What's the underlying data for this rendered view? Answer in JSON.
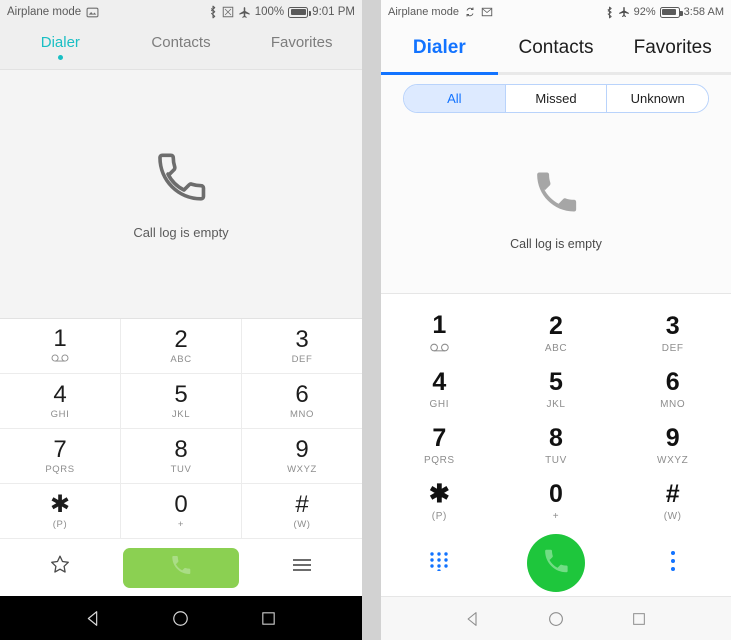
{
  "left_phone": {
    "status_bar": {
      "label": "Airplane mode",
      "icons_left": [
        "screenshot-icon"
      ],
      "icons_right": [
        "bluetooth-icon",
        "sim-icon",
        "airplane-icon"
      ],
      "battery_percent": "100%",
      "time": "9:01 PM"
    },
    "tabs": [
      {
        "label": "Dialer",
        "active": true
      },
      {
        "label": "Contacts",
        "active": false
      },
      {
        "label": "Favorites",
        "active": false
      }
    ],
    "empty_state": {
      "icon": "phone-outline-icon",
      "text": "Call log is empty"
    },
    "keypad": [
      {
        "digit": "1",
        "sub": "∞",
        "sub_is_voicemail": true
      },
      {
        "digit": "2",
        "sub": "ABC"
      },
      {
        "digit": "3",
        "sub": "DEF"
      },
      {
        "digit": "4",
        "sub": "GHI"
      },
      {
        "digit": "5",
        "sub": "JKL"
      },
      {
        "digit": "6",
        "sub": "MNO"
      },
      {
        "digit": "7",
        "sub": "PQRS"
      },
      {
        "digit": "8",
        "sub": "TUV"
      },
      {
        "digit": "9",
        "sub": "WXYZ"
      },
      {
        "digit": "✱",
        "sub": "(P)"
      },
      {
        "digit": "0",
        "sub": "+"
      },
      {
        "digit": "#",
        "sub": "(W)"
      }
    ],
    "action_row": {
      "left_icon": "star-outline-icon",
      "call_icon": "phone-call-icon",
      "right_icon": "hamburger-menu-icon"
    },
    "nav_bar": {
      "back": "back-triangle-icon",
      "home": "home-circle-icon",
      "recents": "recents-square-icon"
    },
    "accent_color": "#19bfc4",
    "call_button_color": "#8bd052"
  },
  "right_phone": {
    "status_bar": {
      "label": "Airplane mode",
      "icons_left": [
        "rotate-icon",
        "mail-icon"
      ],
      "icons_right": [
        "bluetooth-icon",
        "airplane-icon"
      ],
      "battery_percent": "92%",
      "time": "3:58 AM"
    },
    "tabs": [
      {
        "label": "Dialer",
        "active": true
      },
      {
        "label": "Contacts",
        "active": false
      },
      {
        "label": "Favorites",
        "active": false
      }
    ],
    "filters": [
      {
        "label": "All",
        "active": true
      },
      {
        "label": "Missed",
        "active": false
      },
      {
        "label": "Unknown",
        "active": false
      }
    ],
    "empty_state": {
      "icon": "phone-filled-icon",
      "text": "Call log is empty"
    },
    "keypad": [
      {
        "digit": "1",
        "sub": "∞",
        "sub_is_voicemail": true
      },
      {
        "digit": "2",
        "sub": "ABC"
      },
      {
        "digit": "3",
        "sub": "DEF"
      },
      {
        "digit": "4",
        "sub": "GHI"
      },
      {
        "digit": "5",
        "sub": "JKL"
      },
      {
        "digit": "6",
        "sub": "MNO"
      },
      {
        "digit": "7",
        "sub": "PQRS"
      },
      {
        "digit": "8",
        "sub": "TUV"
      },
      {
        "digit": "9",
        "sub": "WXYZ"
      },
      {
        "digit": "✱",
        "sub": "(P)"
      },
      {
        "digit": "0",
        "sub": "+"
      },
      {
        "digit": "#",
        "sub": "(W)"
      }
    ],
    "action_row": {
      "left_icon": "dialpad-grid-icon",
      "call_icon": "phone-call-icon",
      "right_icon": "overflow-menu-icon"
    },
    "nav_bar": {
      "back": "back-triangle-icon",
      "home": "home-circle-icon",
      "recents": "recents-square-icon"
    },
    "accent_color": "#1273ff",
    "call_button_color": "#1ec63c"
  }
}
